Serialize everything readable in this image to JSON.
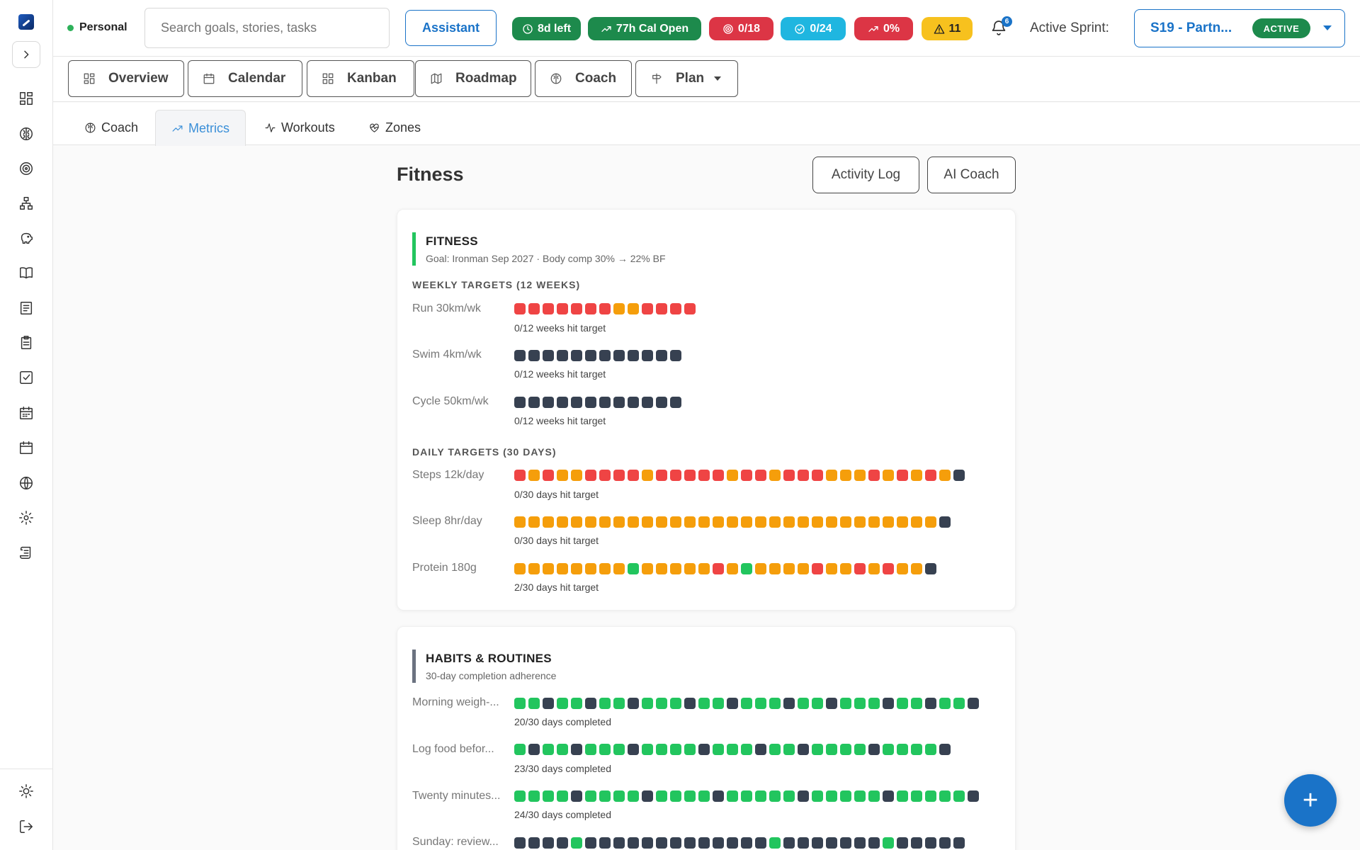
{
  "colors": {
    "red": "#ef4444",
    "orange": "#f59e0b",
    "dark": "#374151",
    "green": "#22c55e",
    "bar_green": "#22c55e",
    "bar_gray": "#6b7280",
    "accent": "#1a73c8"
  },
  "sidebar": {
    "icons": [
      "dashboard-icon",
      "brain-icon",
      "target-icon",
      "hierarchy-icon",
      "piggy-bank-icon",
      "book-icon",
      "notes-icon",
      "clipboard-icon",
      "checkbox-icon",
      "calendar-grid-icon",
      "calendar-icon",
      "globe-icon",
      "gear-icon",
      "scroll-icon"
    ],
    "bottom_icons": [
      "sun-icon",
      "logout-icon"
    ]
  },
  "header": {
    "persona": "Personal",
    "search_placeholder": "Search goals, stories, tasks",
    "assistant_label": "Assistant",
    "pills": [
      {
        "label": "8d left",
        "icon": "clock-icon",
        "color": "#1d8a4c"
      },
      {
        "label": "77h Cal Open",
        "icon": "trend-icon",
        "color": "#1d8a4c"
      },
      {
        "label": "0/18",
        "icon": "target-icon",
        "color": "#dc3545"
      },
      {
        "label": "0/24",
        "icon": "check-circle-icon",
        "color": "#1fb6e0"
      },
      {
        "label": "0%",
        "icon": "trend-icon",
        "color": "#dc3545"
      },
      {
        "label": "11",
        "icon": "warning-icon",
        "color": "#f7c11e"
      }
    ],
    "notifications": "6",
    "sprint_label": "Active Sprint:",
    "sprint_name": "S19 - Partn...",
    "sprint_status": "ACTIVE"
  },
  "main_tabs": [
    "Overview",
    "Calendar",
    "Kanban",
    "Roadmap",
    "Coach",
    "Plan"
  ],
  "sub_tabs": [
    "Coach",
    "Metrics",
    "Workouts",
    "Zones"
  ],
  "page": {
    "title": "Fitness",
    "activity_log": "Activity Log",
    "ai_coach": "AI Coach"
  },
  "fitness_card": {
    "title": "FITNESS",
    "subtitle": "Goal: Ironman Sep 2027 · Body comp 30% → 22% BF",
    "weekly_title": "WEEKLY TARGETS (12 WEEKS)",
    "daily_title": "DAILY TARGETS (30 DAYS)",
    "weekly": [
      {
        "label": "Run 30km/wk",
        "caption": "0/12 weeks hit target",
        "cells": "RRRRRRROORRRR"
      },
      {
        "label": "Swim 4km/wk",
        "caption": "0/12 weeks hit target",
        "cells": "DDDDDDDDDDDD"
      },
      {
        "label": "Cycle 50km/wk",
        "caption": "0/12 weeks hit target",
        "cells": "DDDDDDDDDDDD"
      }
    ],
    "daily": [
      {
        "label": "Steps 12k/day",
        "caption": "0/30 days hit target",
        "cells": "ROROORRRRORRRRRORRORRROOOROROROD"
      },
      {
        "label": "Sleep 8hr/day",
        "caption": "0/30 days hit target",
        "cells": "OOOOOOOOOOOOOOOOOOOOOOOOOOOOOOD"
      },
      {
        "label": "Protein 180g",
        "caption": "2/30 days hit target",
        "cells": "OOOOOOOOGOOOOOROGOOOOROOROROOD"
      }
    ]
  },
  "habits_card": {
    "title": "HABITS & ROUTINES",
    "subtitle": "30-day completion adherence",
    "rows": [
      {
        "label": "Morning weigh-...",
        "caption": "20/30 days completed",
        "cells": "GGDGGDGGDGGGDGGDGGGDGGDGGGDGGDGGD"
      },
      {
        "label": "Log food befor...",
        "caption": "23/30 days completed",
        "cells": "GDGGDGGGDGGGGDGGGDGGDGGGGDGGGGD"
      },
      {
        "label": "Twenty minutes...",
        "caption": "24/30 days completed",
        "cells": "GGGGDGGGGDGGGGDGGGGGDGGGGGDGGGGGD"
      },
      {
        "label": "Sunday: review...",
        "caption": "",
        "cells": "DDDDGDDDDDDDDDDDDDGDDDDDDDGDDDDD"
      }
    ]
  },
  "fab_label": "+"
}
